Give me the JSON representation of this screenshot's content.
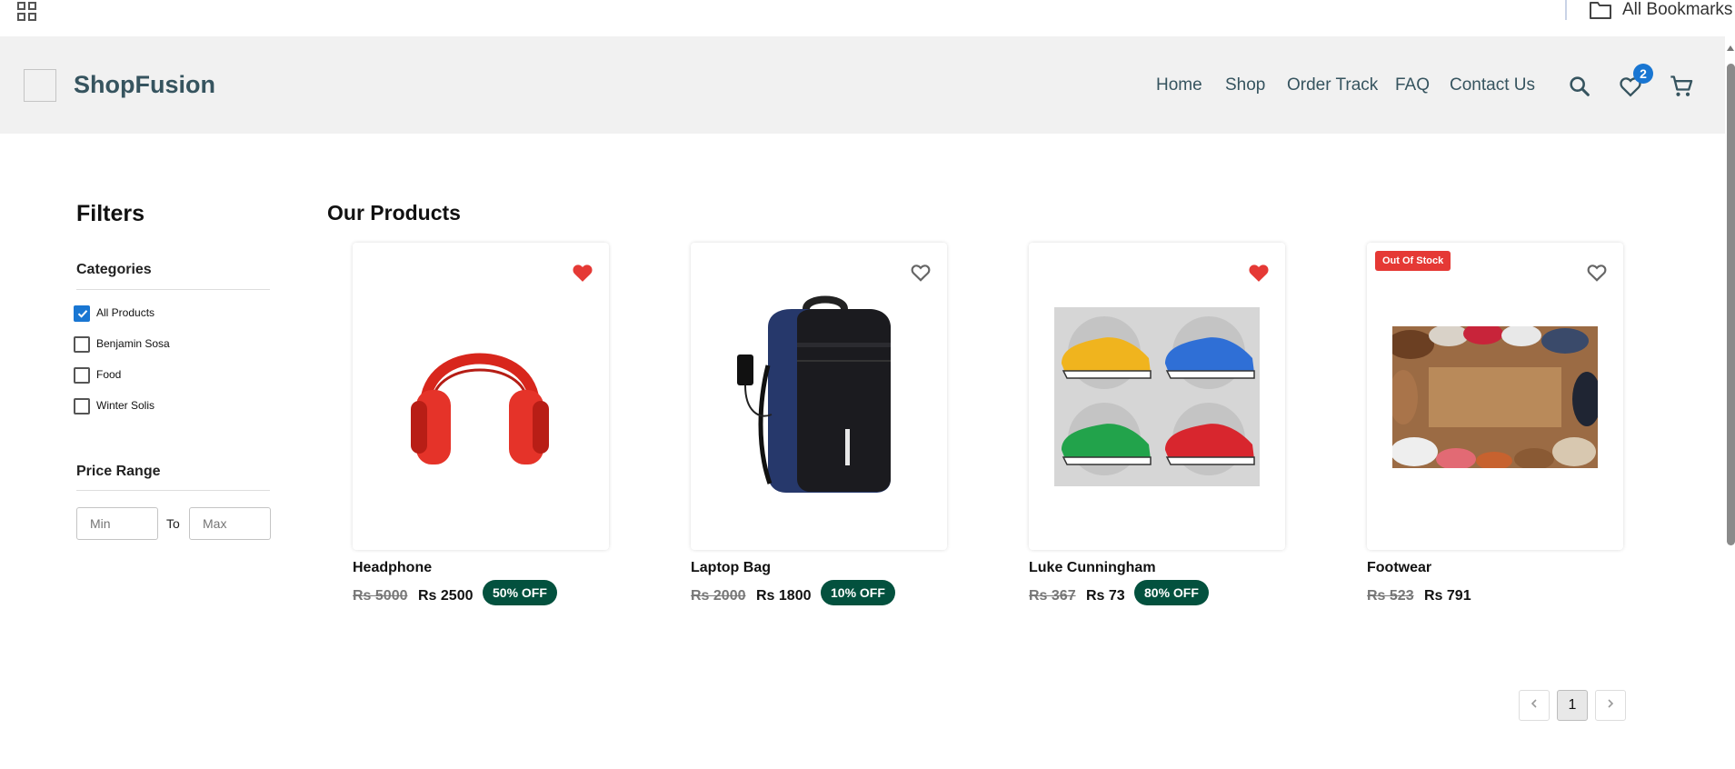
{
  "browser": {
    "bookmarks_label": "All Bookmarks",
    "apps_icon": "apps-grid-icon",
    "folder_icon": "folder-icon"
  },
  "header": {
    "brand": "ShopFusion",
    "nav": [
      "Home",
      "Shop",
      "Order Track",
      "FAQ",
      "Contact Us"
    ],
    "wishlist_count": "2",
    "icons": [
      "search-icon",
      "heart-outline-icon",
      "cart-icon"
    ],
    "accent_color": "#1976d2"
  },
  "filters": {
    "title": "Filters",
    "categories_title": "Categories",
    "categories": [
      {
        "label": "All Products",
        "checked": true
      },
      {
        "label": "Benjamin Sosa",
        "checked": false
      },
      {
        "label": "Food",
        "checked": false
      },
      {
        "label": "Winter Solis",
        "checked": false
      }
    ],
    "price_title": "Price Range",
    "min_placeholder": "Min",
    "max_placeholder": "Max",
    "to_label": "To"
  },
  "products": {
    "title": "Our Products",
    "items": [
      {
        "name": "Headphone",
        "old_price": "Rs 5000",
        "price": "Rs 2500",
        "discount": "50% OFF",
        "favorited": true,
        "badge": "",
        "image": "red-headphones"
      },
      {
        "name": "Laptop Bag",
        "old_price": "Rs 2000",
        "price": "Rs 1800",
        "discount": "10% OFF",
        "favorited": false,
        "badge": "",
        "image": "backpack"
      },
      {
        "name": "Luke Cunningham",
        "old_price": "Rs 367",
        "price": "Rs 73",
        "discount": "80% OFF",
        "favorited": true,
        "badge": "",
        "image": "sneakers-grid"
      },
      {
        "name": "Footwear",
        "old_price": "Rs 523",
        "price": "Rs 791",
        "discount": "",
        "favorited": false,
        "badge": "Out Of Stock",
        "image": "shoes-circle"
      }
    ],
    "colors": {
      "discount": "#03513e",
      "badge": "#e53935",
      "favorite": "#e53935"
    }
  },
  "pagination": {
    "current": "1",
    "prev_icon": "chevron-left-icon",
    "next_icon": "chevron-right-icon"
  }
}
